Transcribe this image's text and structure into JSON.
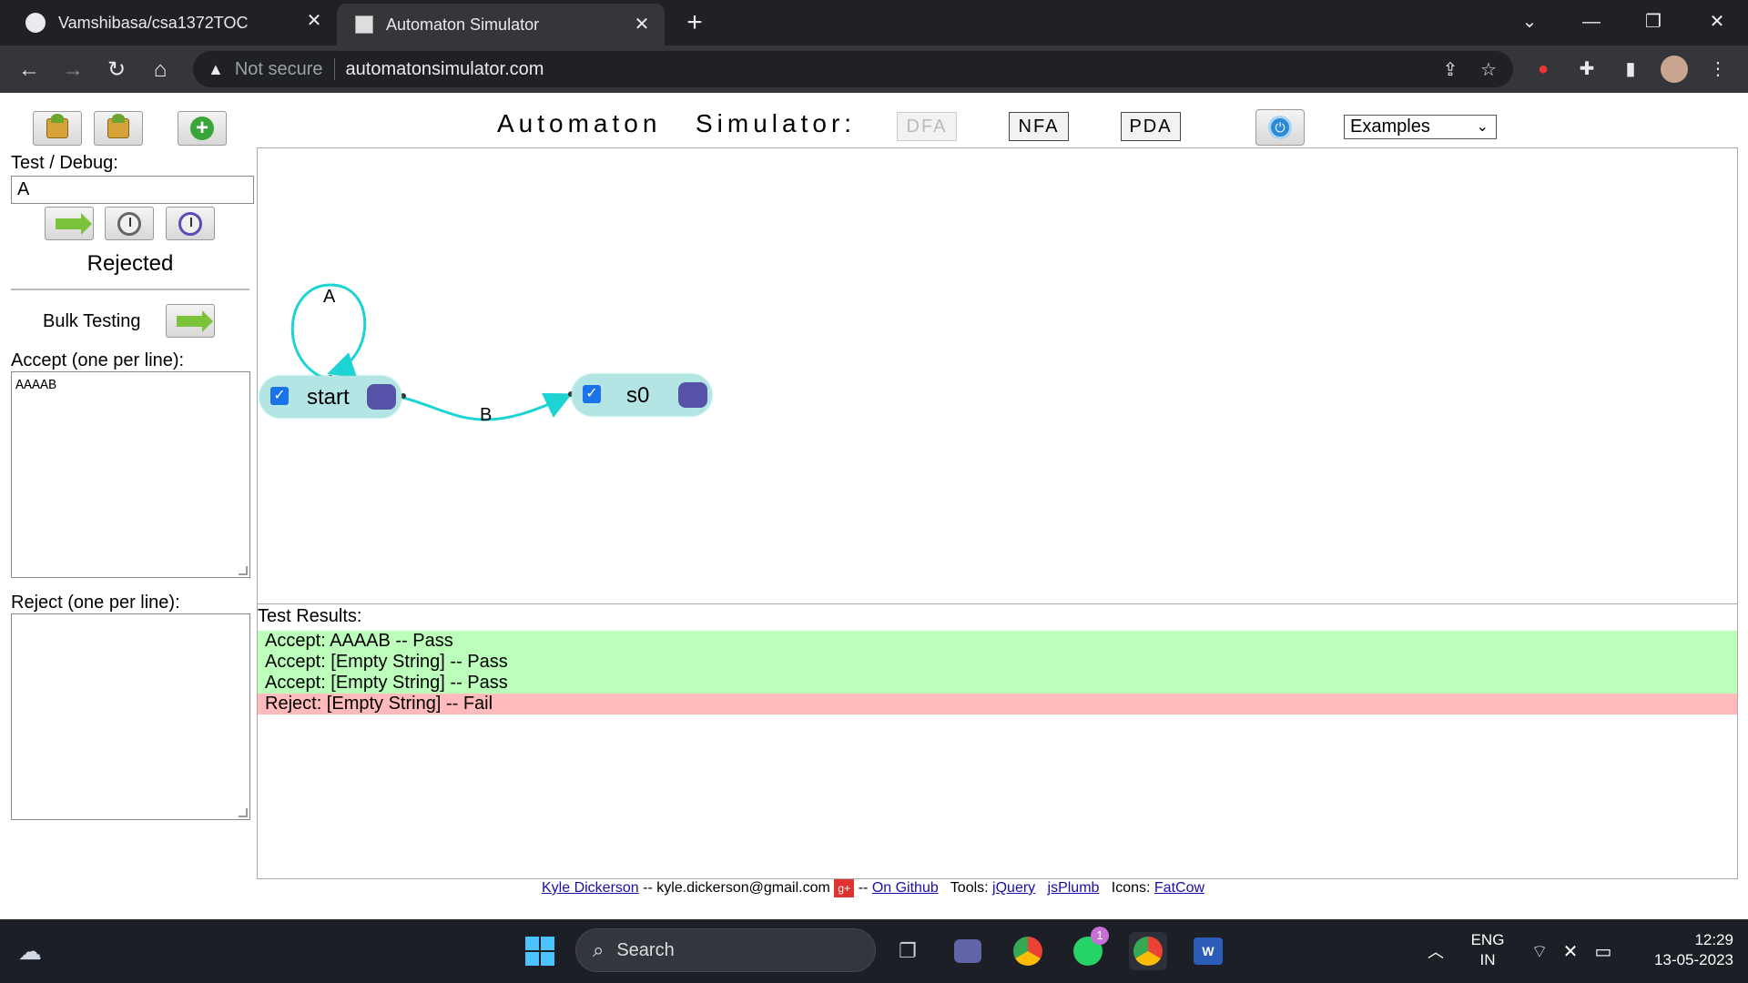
{
  "browser": {
    "tabs": [
      {
        "title": "Vamshibasa/csa1372TOC",
        "active": false
      },
      {
        "title": "Automaton Simulator",
        "active": true
      }
    ],
    "security_label": "Not secure",
    "url": "automatonsimulator.com"
  },
  "app": {
    "title_left": "Automaton",
    "title_right": "Simulator:",
    "modes": [
      {
        "label": "DFA",
        "enabled": false
      },
      {
        "label": "NFA",
        "enabled": true
      },
      {
        "label": "PDA",
        "enabled": true
      }
    ],
    "examples_select": "Examples"
  },
  "sidebar": {
    "test_debug_label": "Test / Debug:",
    "test_input_value": "A",
    "status": "Rejected",
    "bulk_testing_label": "Bulk Testing",
    "accept_label": "Accept (one per line):",
    "accept_value": "AAAAB",
    "reject_label": "Reject (one per line):",
    "reject_value": ""
  },
  "diagram": {
    "states": [
      {
        "name": "start",
        "checked": true
      },
      {
        "name": "s0",
        "checked": true
      }
    ],
    "transitions": [
      {
        "from": "start",
        "to": "start",
        "label": "A"
      },
      {
        "from": "start",
        "to": "s0",
        "label": "B"
      }
    ],
    "edge_color": "#1ed3d3"
  },
  "results": {
    "label": "Test Results:",
    "rows": [
      {
        "text": "Accept: AAAAB -- Pass",
        "status": "pass"
      },
      {
        "text": "Accept: [Empty String] -- Pass",
        "status": "pass"
      },
      {
        "text": "Accept: [Empty String] -- Pass",
        "status": "pass"
      },
      {
        "text": "Reject: [Empty String] -- Fail",
        "status": "fail"
      }
    ]
  },
  "footer": {
    "author": "Kyle Dickerson",
    "sep1": "--",
    "email": "kyle.dickerson@gmail.com",
    "sep2": "--",
    "github": "On Github",
    "tools_label": "Tools:",
    "tool1": "jQuery",
    "tool2": "jsPlumb",
    "icons_label": "Icons:",
    "icons_link": "FatCow"
  },
  "taskbar": {
    "search_label": "Search",
    "lang_line1": "ENG",
    "lang_line2": "IN",
    "time": "12:29",
    "date": "13-05-2023",
    "whatsapp_badge": "1"
  }
}
